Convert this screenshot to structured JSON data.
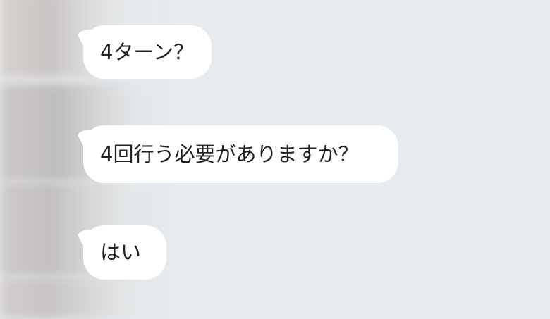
{
  "chat": {
    "messages": [
      {
        "text": "4ターン？"
      },
      {
        "text": "4回行う必要がありますか？"
      },
      {
        "text": "はい"
      }
    ]
  },
  "colors": {
    "background": "#e6ebee",
    "bubble": "#ffffff",
    "text": "#222222"
  }
}
